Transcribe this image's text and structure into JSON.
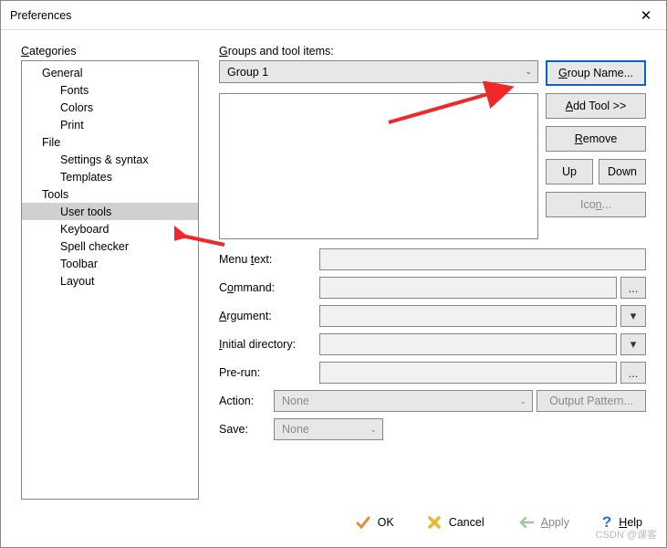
{
  "window": {
    "title": "Preferences"
  },
  "categories": {
    "label": "Categories",
    "items": [
      {
        "label": "General",
        "indent": 1
      },
      {
        "label": "Fonts",
        "indent": 2
      },
      {
        "label": "Colors",
        "indent": 2
      },
      {
        "label": "Print",
        "indent": 2
      },
      {
        "label": "File",
        "indent": 1
      },
      {
        "label": "Settings & syntax",
        "indent": 2
      },
      {
        "label": "Templates",
        "indent": 2
      },
      {
        "label": "Tools",
        "indent": 1
      },
      {
        "label": "User tools",
        "indent": 2,
        "selected": true
      },
      {
        "label": "Keyboard",
        "indent": 2
      },
      {
        "label": "Spell checker",
        "indent": 2
      },
      {
        "label": "Toolbar",
        "indent": 2
      },
      {
        "label": "Layout",
        "indent": 2
      }
    ]
  },
  "right": {
    "groups_label": "Groups and tool items:",
    "group_selected": "Group 1",
    "buttons": {
      "group_name": "Group Name...",
      "add_tool": "Add Tool >>",
      "remove": "Remove",
      "up": "Up",
      "down": "Down",
      "icon": "Icon...",
      "output_pattern": "Output Pattern..."
    },
    "form": {
      "menu_text": "Menu text:",
      "command": "Command:",
      "argument": "Argument:",
      "initial_dir": "Initial directory:",
      "pre_run": "Pre-run:",
      "action": "Action:",
      "action_value": "None",
      "save": "Save:",
      "save_value": "None"
    }
  },
  "footer": {
    "ok": "OK",
    "cancel": "Cancel",
    "apply": "Apply",
    "help": "Help"
  },
  "icons": {
    "ellipsis": "...",
    "dropdown": "▾"
  }
}
